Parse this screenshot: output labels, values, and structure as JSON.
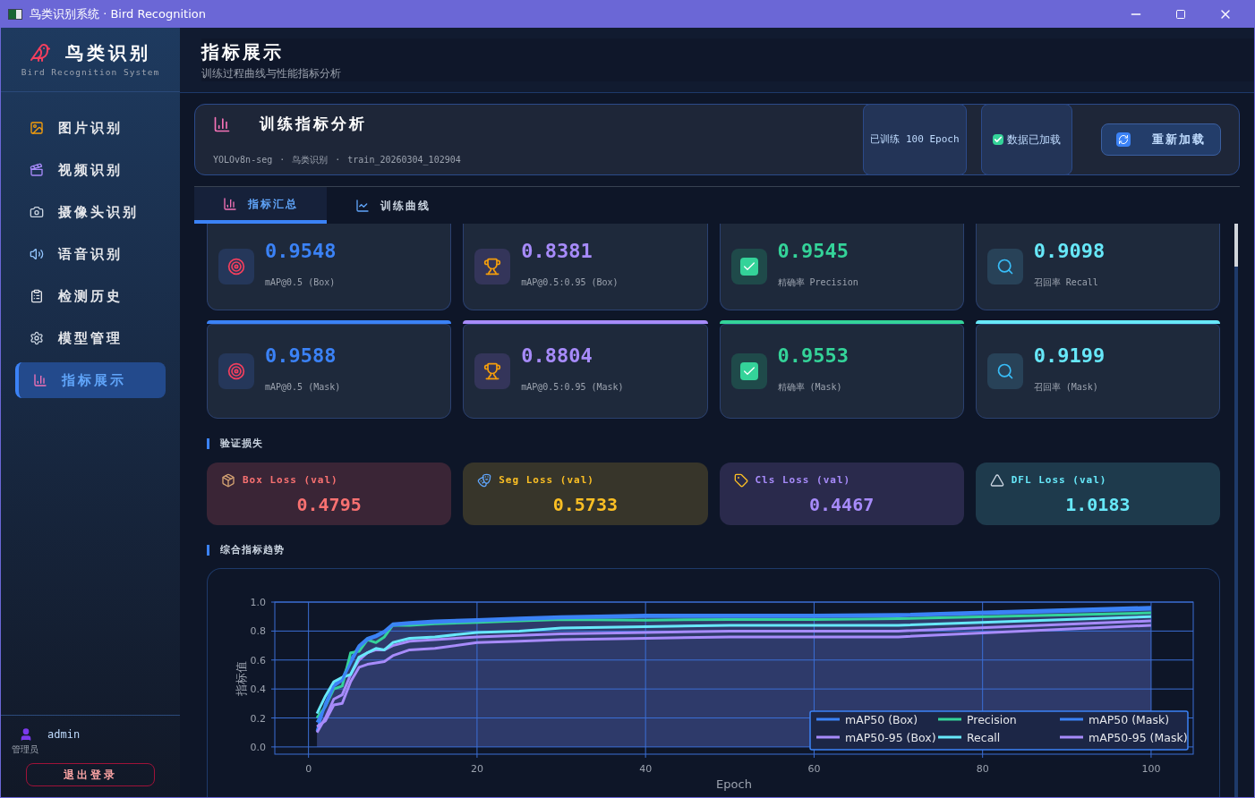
{
  "window": {
    "title": "鸟类识别系统 · Bird Recognition"
  },
  "sidebar": {
    "logo_title": "鸟类识别",
    "logo_subtitle": "Bird Recognition System",
    "items": [
      {
        "label": "图片识别",
        "kind": "image",
        "selected": false
      },
      {
        "label": "视频识别",
        "kind": "video",
        "selected": false
      },
      {
        "label": "摄像头识别",
        "kind": "camera",
        "selected": false
      },
      {
        "label": "语音识别",
        "kind": "audio",
        "selected": false
      },
      {
        "label": "检测历史",
        "kind": "history",
        "selected": false
      },
      {
        "label": "模型管理",
        "kind": "settings",
        "selected": false
      },
      {
        "label": "指标展示",
        "kind": "chart",
        "selected": true
      }
    ],
    "user": {
      "name": "admin",
      "role": "管理员"
    },
    "logout": "退出登录"
  },
  "header": {
    "title": "指标展示",
    "subtitle": "训练过程曲线与性能指标分析"
  },
  "panel": {
    "title": "训练指标分析",
    "meta": [
      "YOLOv8n-seg",
      "鸟类识别",
      "train_20260304_102904"
    ],
    "separator": "·",
    "epoch_badge": "已训练 100 Epoch",
    "loaded_badge": {
      "label": "数据已加载",
      "checked": true
    },
    "reload_button": "重新加载"
  },
  "tabs": [
    {
      "label": "指标汇总",
      "kind": "summary",
      "selected": true
    },
    {
      "label": "训练曲线",
      "kind": "curve",
      "selected": false
    }
  ],
  "metric_rows": [
    {
      "accent_bar": false,
      "cards": [
        {
          "value": "0.9548",
          "label": "mAP@0.5 (Box)",
          "kind": "target",
          "color": "#3b82f6"
        },
        {
          "value": "0.8381",
          "label": "mAP@0.5:0.95 (Box)",
          "kind": "trophy",
          "color": "#a78bfa"
        },
        {
          "value": "0.9545",
          "label": "精确率 Precision",
          "kind": "check",
          "color": "#34d399"
        },
        {
          "value": "0.9098",
          "label": "召回率 Recall",
          "kind": "search",
          "color": "#67e8f9"
        }
      ]
    },
    {
      "accent_bar": true,
      "cards": [
        {
          "value": "0.9588",
          "label": "mAP@0.5 (Mask)",
          "kind": "target",
          "color": "#3b82f6"
        },
        {
          "value": "0.8804",
          "label": "mAP@0.5:0.95 (Mask)",
          "kind": "trophy",
          "color": "#a78bfa"
        },
        {
          "value": "0.9553",
          "label": "精确率 (Mask)",
          "kind": "check",
          "color": "#34d399"
        },
        {
          "value": "0.9199",
          "label": "召回率 (Mask)",
          "kind": "search",
          "color": "#67e8f9"
        }
      ]
    }
  ],
  "loss_section": {
    "title": "验证损失",
    "cards": [
      {
        "label": "Box Loss (val)",
        "value": "0.4795",
        "kind": "box",
        "color": "#f87171"
      },
      {
        "label": "Seg Loss (val)",
        "value": "0.5733",
        "kind": "masks",
        "color": "#fbbf24"
      },
      {
        "label": "Cls Loss (val)",
        "value": "0.4467",
        "kind": "tag",
        "color": "#a78bfa"
      },
      {
        "label": "DFL Loss (val)",
        "value": "1.0183",
        "kind": "ruler",
        "color": "#67e8f9"
      }
    ]
  },
  "trend_section": {
    "title": "综合指标趋势",
    "chart_data": {
      "type": "line",
      "xlabel": "Epoch",
      "ylabel": "指标值",
      "grid": true,
      "legend": true,
      "x": [
        1,
        2,
        3,
        4,
        5,
        6,
        7,
        8,
        9,
        10,
        12,
        15,
        20,
        25,
        30,
        40,
        50,
        60,
        70,
        100
      ],
      "series": [
        {
          "name": "mAP50 (Box)",
          "color": "#3b82f6",
          "values": [
            0.11,
            0.3,
            0.43,
            0.47,
            0.6,
            0.7,
            0.75,
            0.77,
            0.8,
            0.85,
            0.86,
            0.87,
            0.88,
            0.89,
            0.9,
            0.91,
            0.91,
            0.91,
            0.915,
            0.965
          ]
        },
        {
          "name": "mAP50-95 (Box)",
          "color": "#a78bfa",
          "values": [
            0.1,
            0.2,
            0.33,
            0.36,
            0.5,
            0.6,
            0.65,
            0.67,
            0.67,
            0.7,
            0.73,
            0.74,
            0.76,
            0.77,
            0.78,
            0.79,
            0.8,
            0.8,
            0.8,
            0.87
          ]
        },
        {
          "name": "Precision",
          "color": "#34d399",
          "values": [
            0.2,
            0.28,
            0.4,
            0.42,
            0.65,
            0.66,
            0.74,
            0.72,
            0.76,
            0.84,
            0.84,
            0.85,
            0.86,
            0.87,
            0.88,
            0.875,
            0.88,
            0.88,
            0.885,
            0.925
          ]
        },
        {
          "name": "Recall",
          "color": "#67e8f9",
          "values": [
            0.23,
            0.35,
            0.45,
            0.48,
            0.5,
            0.62,
            0.65,
            0.68,
            0.67,
            0.72,
            0.75,
            0.76,
            0.79,
            0.8,
            0.82,
            0.83,
            0.84,
            0.84,
            0.84,
            0.9
          ]
        },
        {
          "name": "mAP50 (Mask)",
          "color": "#3b82f6",
          "values": [
            0.17,
            0.28,
            0.42,
            0.46,
            0.58,
            0.69,
            0.74,
            0.76,
            0.79,
            0.84,
            0.85,
            0.86,
            0.87,
            0.88,
            0.89,
            0.9,
            0.9,
            0.9,
            0.905,
            0.95
          ]
        },
        {
          "name": "mAP50-95 (Mask)",
          "color": "#a78bfa",
          "values": [
            0.14,
            0.18,
            0.29,
            0.3,
            0.45,
            0.55,
            0.57,
            0.58,
            0.59,
            0.63,
            0.67,
            0.68,
            0.72,
            0.73,
            0.74,
            0.75,
            0.76,
            0.76,
            0.76,
            0.84
          ]
        }
      ],
      "xlim": [
        -4,
        105
      ],
      "ylim": [
        -0.05,
        1.0
      ],
      "xticks": [
        0,
        20,
        40,
        60,
        80,
        100
      ],
      "yticks": [
        {
          "value": 0,
          "label": "0.0"
        },
        {
          "value": 0.2,
          "label": "0.2"
        },
        {
          "value": 0.4,
          "label": "0.4"
        },
        {
          "value": 0.6,
          "label": "0.6"
        },
        {
          "value": 0.8,
          "label": "0.8"
        },
        {
          "value": 1,
          "label": "1.0"
        }
      ]
    }
  }
}
